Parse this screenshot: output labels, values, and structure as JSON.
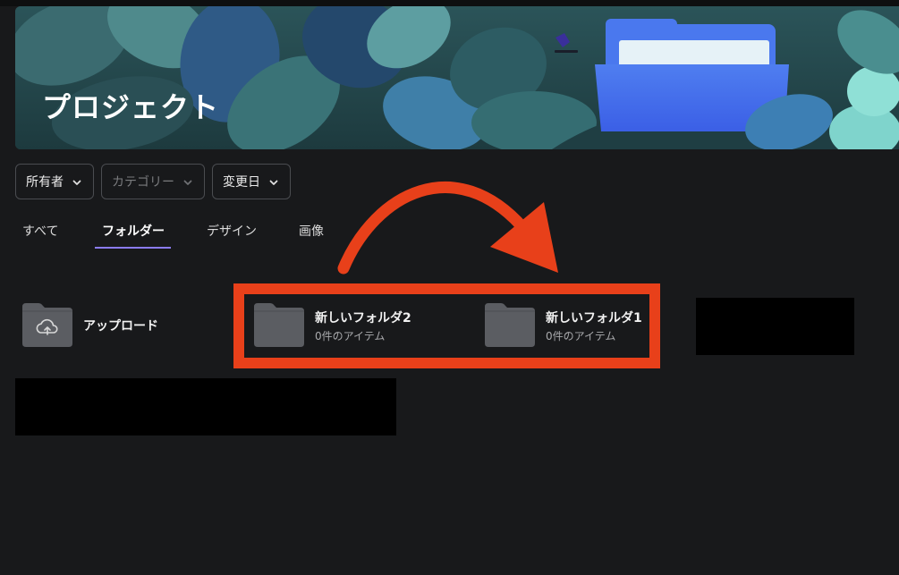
{
  "banner": {
    "title": "プロジェクト"
  },
  "filters": [
    {
      "label": "所有者",
      "state": "enabled"
    },
    {
      "label": "カテゴリー",
      "state": "disabled"
    },
    {
      "label": "変更日",
      "state": "enabled"
    }
  ],
  "tabs": [
    {
      "label": "すべて",
      "active": false
    },
    {
      "label": "フォルダー",
      "active": true
    },
    {
      "label": "デザイン",
      "active": false
    },
    {
      "label": "画像",
      "active": false
    }
  ],
  "items": {
    "upload": {
      "name": "アップロード",
      "icon": "cloud-upload-icon"
    },
    "folder2": {
      "name": "新しいフォルダ2",
      "meta": "0件のアイテム",
      "icon": "folder-icon"
    },
    "folder1": {
      "name": "新しいフォルダ1",
      "meta": "0件のアイテム",
      "icon": "folder-icon"
    }
  },
  "colors": {
    "background": "#18191b",
    "tab_accent": "#8b7cf6",
    "annotation": "#e8401a",
    "folder": "#5b5d62"
  }
}
